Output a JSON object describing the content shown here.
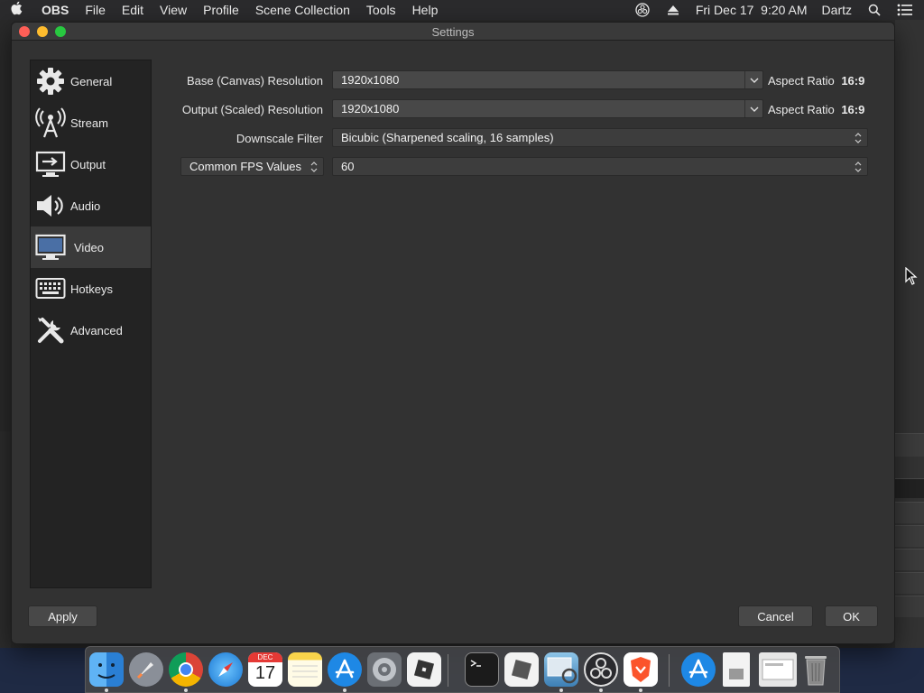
{
  "menubar": {
    "app_name": "OBS",
    "items": [
      "File",
      "Edit",
      "View",
      "Profile",
      "Scene Collection",
      "Tools",
      "Help"
    ],
    "datetime": "Fri Dec 17  9:20 AM",
    "user": "Dartz"
  },
  "window": {
    "title": "Settings"
  },
  "sidebar": {
    "items": [
      {
        "label": "General",
        "icon": "gear-icon"
      },
      {
        "label": "Stream",
        "icon": "broadcast-tower-icon"
      },
      {
        "label": "Output",
        "icon": "output-monitor-icon"
      },
      {
        "label": "Audio",
        "icon": "speaker-icon"
      },
      {
        "label": "Video",
        "icon": "monitor-icon",
        "active": true
      },
      {
        "label": "Hotkeys",
        "icon": "keyboard-icon"
      },
      {
        "label": "Advanced",
        "icon": "wrench-screwdriver-icon"
      }
    ]
  },
  "video": {
    "base_label": "Base (Canvas) Resolution",
    "base_value": "1920x1080",
    "base_aspect_prefix": "Aspect Ratio",
    "base_aspect_value": "16:9",
    "output_label": "Output (Scaled) Resolution",
    "output_value": "1920x1080",
    "output_aspect_prefix": "Aspect Ratio",
    "output_aspect_value": "16:9",
    "downscale_label": "Downscale Filter",
    "downscale_value": "Bicubic (Sharpened scaling, 16 samples)",
    "fps_type": "Common FPS Values",
    "fps_value": "60"
  },
  "buttons": {
    "apply": "Apply",
    "cancel": "Cancel",
    "ok": "OK"
  },
  "dock": {
    "calendar_month": "DEC",
    "calendar_day": "17",
    "apps": [
      "finder-icon",
      "launchpad-icon",
      "chrome-icon",
      "safari-icon",
      "calendar-icon",
      "notes-icon",
      "app-store-icon",
      "system-preferences-icon",
      "roblox-icon",
      "terminal-icon",
      "roblox-studio-icon",
      "preview-icon",
      "obs-icon",
      "brave-icon",
      "app-store-downloads-icon",
      "document-icon",
      "screenshot-icon",
      "trash-icon"
    ]
  },
  "colors": {
    "window_bg": "#323232",
    "sidebar_bg": "#232323",
    "control_bg": "#484848",
    "selected_nav": "#3a3a3a"
  }
}
